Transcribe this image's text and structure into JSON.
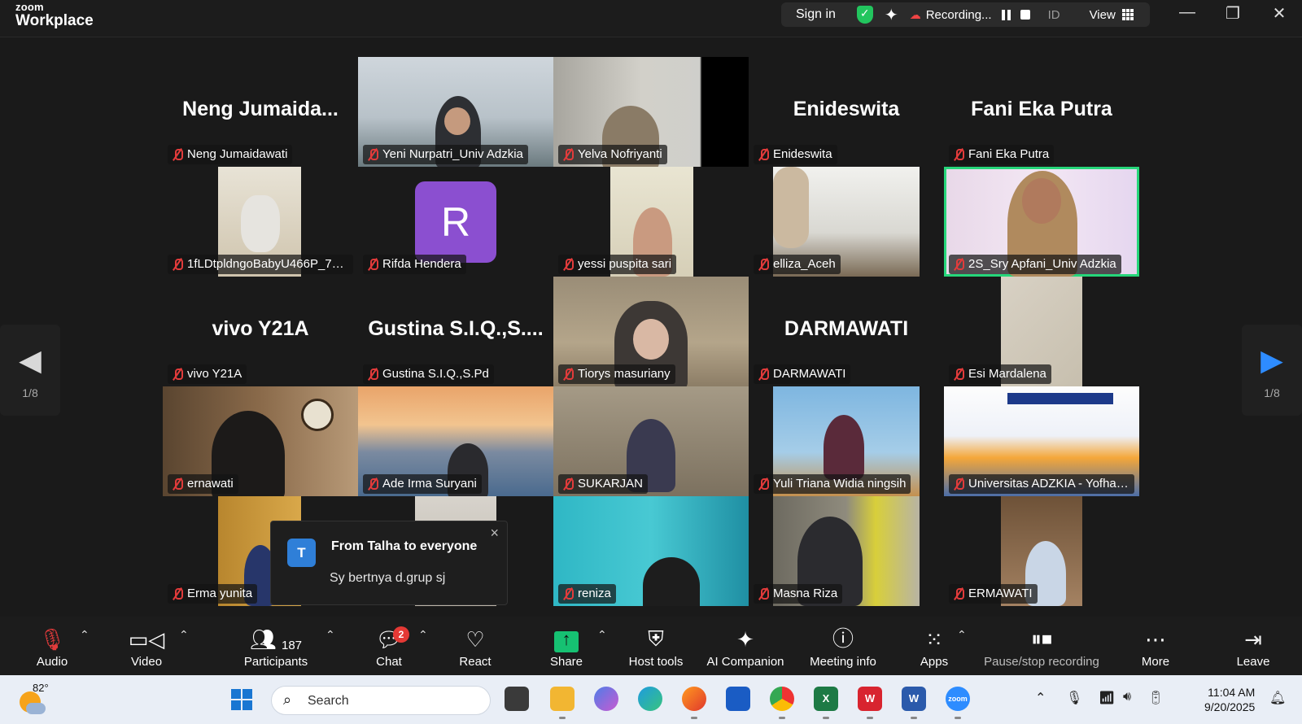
{
  "app": {
    "brand_top": "zoom",
    "brand_bottom": "Workplace"
  },
  "topbar": {
    "signin": "Sign in",
    "recording": "Recording...",
    "id_label": "ID",
    "view_label": "View"
  },
  "gallery": {
    "page_left": "1/8",
    "page_right": "1/8",
    "tiles": [
      {
        "name": "Neng Jumaidawati",
        "big": "Neng  Jumaida..."
      },
      {
        "name": "Yeni Nurpatri_Univ Adzkia",
        "big": ""
      },
      {
        "name": "Yelva Nofriyanti",
        "big": ""
      },
      {
        "name": "Enideswita",
        "big": "Enideswita"
      },
      {
        "name": "Fani Eka Putra",
        "big": "Fani Eka Putra"
      },
      {
        "name": "1fLDtpldngoBabyU466P_701...",
        "big": ""
      },
      {
        "name": "Rifda Hendera",
        "big": "",
        "initial": "R"
      },
      {
        "name": "yessi puspita sari",
        "big": ""
      },
      {
        "name": "elliza_Aceh",
        "big": ""
      },
      {
        "name": "2S_Sry Apfani_Univ Adzkia",
        "big": ""
      },
      {
        "name": "vivo Y21A",
        "big": "vivo Y21A"
      },
      {
        "name": "Gustina S.I.Q.,S.Pd",
        "big": "Gustina  S.I.Q.,S...."
      },
      {
        "name": "Tiorys masuriany",
        "big": ""
      },
      {
        "name": "DARMAWATI",
        "big": "DARMAWATI"
      },
      {
        "name": "Esi Mardalena",
        "big": ""
      },
      {
        "name": "ernawati",
        "big": ""
      },
      {
        "name": "Ade Irma Suryani",
        "big": ""
      },
      {
        "name": "SUKARJAN",
        "big": ""
      },
      {
        "name": "Yuli Triana Widia ningsih",
        "big": ""
      },
      {
        "name": "Universitas ADZKIA - Yofhan...",
        "big": ""
      },
      {
        "name": "Erma yunita",
        "big": ""
      },
      {
        "name": "",
        "big": ""
      },
      {
        "name": "reniza",
        "big": ""
      },
      {
        "name": "Masna Riza",
        "big": ""
      },
      {
        "name": "ERMAWATI",
        "big": ""
      }
    ]
  },
  "chat_toast": {
    "initial": "T",
    "from": "From Talha to everyone",
    "message": "Sy bertnya d.grup sj",
    "close": "×"
  },
  "toolbar": {
    "audio": "Audio",
    "video": "Video",
    "participants": "Participants",
    "participant_count": "187",
    "chat": "Chat",
    "chat_badge": "2",
    "react": "React",
    "share": "Share",
    "host_tools": "Host tools",
    "ai_companion": "AI Companion",
    "meeting_info": "Meeting info",
    "apps": "Apps",
    "pause_stop": "Pause/stop recording",
    "more": "More",
    "leave": "Leave"
  },
  "taskbar": {
    "temperature": "82°",
    "search_placeholder": "Search",
    "time": "11:04 AM",
    "date": "9/20/2025"
  },
  "colors": {
    "active_speaker": "#26d67a",
    "muted": "#e23b3b",
    "share_green": "#16c172",
    "badge_red": "#e53935"
  }
}
